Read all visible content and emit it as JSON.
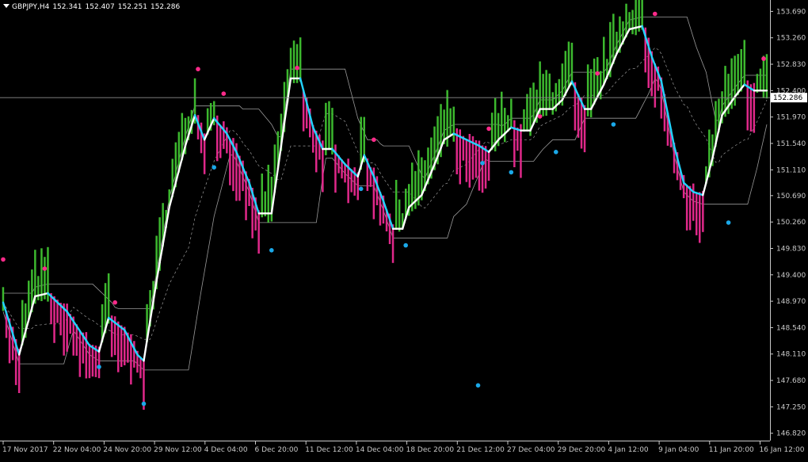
{
  "header": {
    "symbol": "GBPJPY,H4",
    "open": "152.341",
    "high": "152.407",
    "low": "152.251",
    "close": "152.286"
  },
  "chart_data": {
    "type": "bar",
    "colors": {
      "background": "#000000",
      "up_bar": "#3cb82e",
      "down_bar": "#e0288a",
      "dot_up": "#1aa8e8",
      "dot_down": "#ff2a8a",
      "line_white": "#ffffff",
      "line_cyan": "#22d4ff",
      "channel": "#9a9a9a",
      "axis": "#c8c8c8"
    },
    "ylim": [
      146.7,
      153.85
    ],
    "y_ticks": [
      "153.690",
      "153.260",
      "152.830",
      "152.400",
      "151.970",
      "151.540",
      "151.110",
      "150.690",
      "150.260",
      "149.830",
      "149.400",
      "148.970",
      "148.540",
      "148.110",
      "147.680",
      "147.250",
      "146.820"
    ],
    "x_ticks": [
      "17 Nov 2017",
      "22 Nov 04:00",
      "24 Nov 20:00",
      "29 Nov 12:00",
      "4 Dec 04:00",
      "6 Dec 20:00",
      "11 Dec 12:00",
      "14 Dec 04:00",
      "18 Dec 20:00",
      "21 Dec 12:00",
      "27 Dec 04:00",
      "29 Dec 20:00",
      "4 Jan 12:00",
      "9 Jan 04:00",
      "11 Jan 20:00",
      "16 Jan 12:00"
    ],
    "current_price": "152.286",
    "bar_count": 240,
    "keypoints": [
      [
        0,
        148.95
      ],
      [
        5,
        148.1
      ],
      [
        10,
        149.05
      ],
      [
        14,
        149.1
      ],
      [
        20,
        148.8
      ],
      [
        27,
        148.25
      ],
      [
        30,
        148.15
      ],
      [
        33,
        148.7
      ],
      [
        38,
        148.5
      ],
      [
        42,
        148.1
      ],
      [
        44,
        148.0
      ],
      [
        48,
        149.3
      ],
      [
        52,
        150.5
      ],
      [
        57,
        151.5
      ],
      [
        60,
        152.0
      ],
      [
        63,
        151.6
      ],
      [
        66,
        151.95
      ],
      [
        70,
        151.7
      ],
      [
        73,
        151.4
      ],
      [
        77,
        150.9
      ],
      [
        80,
        150.4
      ],
      [
        84,
        150.4
      ],
      [
        87,
        151.5
      ],
      [
        90,
        152.6
      ],
      [
        93,
        152.6
      ],
      [
        97,
        151.8
      ],
      [
        100,
        151.45
      ],
      [
        103,
        151.45
      ],
      [
        107,
        151.2
      ],
      [
        111,
        151.0
      ],
      [
        113,
        151.35
      ],
      [
        116,
        151.0
      ],
      [
        119,
        150.6
      ],
      [
        122,
        150.15
      ],
      [
        125,
        150.15
      ],
      [
        127,
        150.5
      ],
      [
        131,
        150.7
      ],
      [
        135,
        151.2
      ],
      [
        138,
        151.6
      ],
      [
        141,
        151.7
      ],
      [
        145,
        151.6
      ],
      [
        149,
        151.5
      ],
      [
        152,
        151.4
      ],
      [
        155,
        151.6
      ],
      [
        159,
        151.8
      ],
      [
        162,
        151.75
      ],
      [
        165,
        151.75
      ],
      [
        168,
        152.1
      ],
      [
        172,
        152.1
      ],
      [
        175,
        152.25
      ],
      [
        178,
        152.55
      ],
      [
        182,
        152.1
      ],
      [
        184,
        152.1
      ],
      [
        188,
        152.5
      ],
      [
        192,
        153.0
      ],
      [
        196,
        153.4
      ],
      [
        200,
        153.45
      ],
      [
        203,
        152.95
      ],
      [
        206,
        152.55
      ],
      [
        210,
        151.5
      ],
      [
        213,
        150.9
      ],
      [
        216,
        150.75
      ],
      [
        219,
        150.7
      ],
      [
        222,
        151.3
      ],
      [
        225,
        152.0
      ],
      [
        229,
        152.3
      ],
      [
        232,
        152.5
      ],
      [
        235,
        152.4
      ]
    ],
    "up_dots": [
      {
        "x": 148.62,
        "y": 147.6
      },
      {
        "x": 30,
        "y": 147.9
      },
      {
        "x": 44,
        "y": 147.3
      },
      {
        "x": 66,
        "y": 151.15
      },
      {
        "x": 84,
        "y": 149.8
      },
      {
        "x": 112,
        "y": 150.8
      },
      {
        "x": 126,
        "y": 149.88
      },
      {
        "x": 150,
        "y": 151.22
      },
      {
        "x": 159,
        "y": 151.07
      },
      {
        "x": 173,
        "y": 151.4
      },
      {
        "x": 191,
        "y": 151.85
      },
      {
        "x": 227,
        "y": 150.25
      }
    ],
    "down_dots": [
      {
        "x": 0,
        "y": 149.65
      },
      {
        "x": 13,
        "y": 149.5
      },
      {
        "x": 35,
        "y": 148.95
      },
      {
        "x": 61,
        "y": 152.75
      },
      {
        "x": 69,
        "y": 152.35
      },
      {
        "x": 92,
        "y": 152.77
      },
      {
        "x": 116,
        "y": 151.6
      },
      {
        "x": 152,
        "y": 151.78
      },
      {
        "x": 168,
        "y": 151.98
      },
      {
        "x": 186,
        "y": 152.68
      },
      {
        "x": 204,
        "y": 153.65
      },
      {
        "x": 238,
        "y": 152.92
      }
    ]
  }
}
